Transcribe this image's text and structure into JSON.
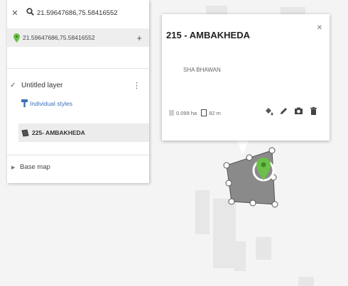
{
  "search": {
    "query": "21.59647686,75.58416552"
  },
  "result": {
    "coords": "21.59647686,75.58416552"
  },
  "layer": {
    "name": "Untitled layer",
    "styles_label": "Individual styles",
    "feature_label": "225- AMBAKHEDA"
  },
  "basemap": {
    "label": "Base map"
  },
  "popup": {
    "title": "215 - AMBAKHEDA",
    "description": "SHA BHAWAN",
    "area": "0.099 ha",
    "perimeter": "82 m"
  },
  "colors": {
    "pin": "#6cc04a",
    "polygon_fill": "#8a8a8a",
    "link": "#3b6fb8"
  },
  "icons": {
    "close": "close-icon",
    "search": "search-icon",
    "pin": "map-pin-icon",
    "add": "plus-icon",
    "checkbox": "checkbox-checked-icon",
    "menu": "more-vert-icon",
    "style": "paint-brush-icon",
    "polygon": "polygon-icon",
    "expand": "chevron-right-icon",
    "fill": "fill-color-icon",
    "edit": "pencil-icon",
    "camera": "camera-icon",
    "delete": "trash-icon"
  }
}
